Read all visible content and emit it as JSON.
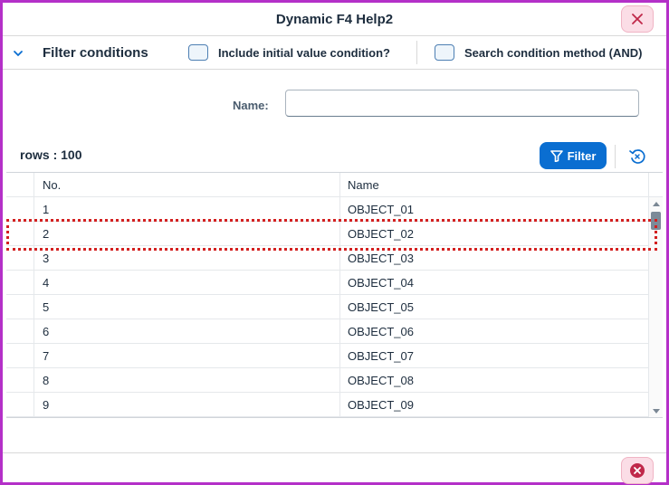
{
  "dialog": {
    "title": "Dynamic F4 Help2"
  },
  "filter_bar": {
    "title": "Filter conditions",
    "include_initial_label": "Include initial value condition?",
    "search_method_label": "Search condition method (AND)"
  },
  "search": {
    "name_label": "Name:",
    "name_value": ""
  },
  "toolbar": {
    "rows_count": "rows : 100",
    "filter_label": "Filter"
  },
  "table": {
    "columns": [
      "No.",
      "Name"
    ],
    "rows": [
      {
        "no": "1",
        "name": "OBJECT_01"
      },
      {
        "no": "2",
        "name": "OBJECT_02"
      },
      {
        "no": "3",
        "name": "OBJECT_03"
      },
      {
        "no": "4",
        "name": "OBJECT_04"
      },
      {
        "no": "5",
        "name": "OBJECT_05"
      },
      {
        "no": "6",
        "name": "OBJECT_06"
      },
      {
        "no": "7",
        "name": "OBJECT_07"
      },
      {
        "no": "8",
        "name": "OBJECT_08"
      },
      {
        "no": "9",
        "name": "OBJECT_09"
      }
    ],
    "highlighted_row": 2
  },
  "colors": {
    "accent": "#0a6ed1",
    "frame": "#b430c8",
    "close_button_bg": "#fbdde6",
    "highlight": "#d32020"
  },
  "icons": {
    "close": "close-icon",
    "collapse": "chevron-down-icon",
    "filter": "filter-icon",
    "reset": "reset-icon",
    "footer_close": "cancel-circle-icon"
  }
}
